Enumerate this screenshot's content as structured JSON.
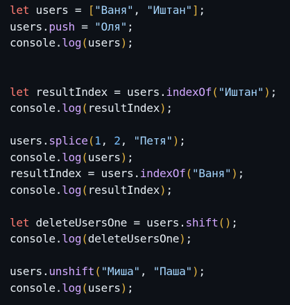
{
  "colors": {
    "background": "#0d1117",
    "plain": "#e6edf3",
    "keyword": "#ff7b72",
    "method": "#d2a8ff",
    "string": "#a5d6ff",
    "number": "#79c0ff",
    "bracket_outer": "#e3b341",
    "bracket_inner": "#d2a8ff"
  },
  "lines": [
    [
      {
        "t": "let",
        "c": "keyword"
      },
      {
        "t": " users = ",
        "c": "plain"
      },
      {
        "t": "[",
        "c": "bracket_outer"
      },
      {
        "t": "\"Ваня\"",
        "c": "string"
      },
      {
        "t": ", ",
        "c": "plain"
      },
      {
        "t": "\"Иштан\"",
        "c": "string"
      },
      {
        "t": "]",
        "c": "bracket_outer"
      },
      {
        "t": ";",
        "c": "plain"
      }
    ],
    [
      {
        "t": "users.",
        "c": "plain"
      },
      {
        "t": "push",
        "c": "method"
      },
      {
        "t": " = ",
        "c": "plain"
      },
      {
        "t": "\"Оля\"",
        "c": "string"
      },
      {
        "t": ";",
        "c": "plain"
      }
    ],
    [
      {
        "t": "console.",
        "c": "plain"
      },
      {
        "t": "log",
        "c": "method"
      },
      {
        "t": "(",
        "c": "bracket_outer"
      },
      {
        "t": "users",
        "c": "plain"
      },
      {
        "t": ")",
        "c": "bracket_outer"
      },
      {
        "t": ";",
        "c": "plain"
      }
    ],
    [],
    [],
    [
      {
        "t": "let",
        "c": "keyword"
      },
      {
        "t": " resultIndex = users.",
        "c": "plain"
      },
      {
        "t": "indexOf",
        "c": "method"
      },
      {
        "t": "(",
        "c": "bracket_outer"
      },
      {
        "t": "\"Иштан\"",
        "c": "string"
      },
      {
        "t": ")",
        "c": "bracket_outer"
      },
      {
        "t": ";",
        "c": "plain"
      }
    ],
    [
      {
        "t": "console.",
        "c": "plain"
      },
      {
        "t": "log",
        "c": "method"
      },
      {
        "t": "(",
        "c": "bracket_outer"
      },
      {
        "t": "resultIndex",
        "c": "plain"
      },
      {
        "t": ")",
        "c": "bracket_outer"
      },
      {
        "t": ";",
        "c": "plain"
      }
    ],
    [],
    [
      {
        "t": "users.",
        "c": "plain"
      },
      {
        "t": "splice",
        "c": "method"
      },
      {
        "t": "(",
        "c": "bracket_outer"
      },
      {
        "t": "1",
        "c": "number"
      },
      {
        "t": ", ",
        "c": "plain"
      },
      {
        "t": "2",
        "c": "number"
      },
      {
        "t": ", ",
        "c": "plain"
      },
      {
        "t": "\"Петя\"",
        "c": "string"
      },
      {
        "t": ")",
        "c": "bracket_outer"
      },
      {
        "t": ";",
        "c": "plain"
      }
    ],
    [
      {
        "t": "console.",
        "c": "plain"
      },
      {
        "t": "log",
        "c": "method"
      },
      {
        "t": "(",
        "c": "bracket_outer"
      },
      {
        "t": "users",
        "c": "plain"
      },
      {
        "t": ")",
        "c": "bracket_outer"
      },
      {
        "t": ";",
        "c": "plain"
      }
    ],
    [
      {
        "t": "resultIndex = users.",
        "c": "plain"
      },
      {
        "t": "indexOf",
        "c": "method"
      },
      {
        "t": "(",
        "c": "bracket_outer"
      },
      {
        "t": "\"Ваня\"",
        "c": "string"
      },
      {
        "t": ")",
        "c": "bracket_outer"
      },
      {
        "t": ";",
        "c": "plain"
      }
    ],
    [
      {
        "t": "console.",
        "c": "plain"
      },
      {
        "t": "log",
        "c": "method"
      },
      {
        "t": "(",
        "c": "bracket_outer"
      },
      {
        "t": "resultIndex",
        "c": "plain"
      },
      {
        "t": ")",
        "c": "bracket_outer"
      },
      {
        "t": ";",
        "c": "plain"
      }
    ],
    [],
    [
      {
        "t": "let",
        "c": "keyword"
      },
      {
        "t": " deleteUsersOne = users.",
        "c": "plain"
      },
      {
        "t": "shift",
        "c": "method"
      },
      {
        "t": "(",
        "c": "bracket_outer"
      },
      {
        "t": ")",
        "c": "bracket_outer"
      },
      {
        "t": ";",
        "c": "plain"
      }
    ],
    [
      {
        "t": "console.",
        "c": "plain"
      },
      {
        "t": "log",
        "c": "method"
      },
      {
        "t": "(",
        "c": "bracket_outer"
      },
      {
        "t": "deleteUsersOne",
        "c": "plain"
      },
      {
        "t": ")",
        "c": "bracket_outer"
      },
      {
        "t": ";",
        "c": "plain"
      }
    ],
    [],
    [
      {
        "t": "users.",
        "c": "plain"
      },
      {
        "t": "unshift",
        "c": "method"
      },
      {
        "t": "(",
        "c": "bracket_outer"
      },
      {
        "t": "\"Миша\"",
        "c": "string"
      },
      {
        "t": ", ",
        "c": "plain"
      },
      {
        "t": "\"Паша\"",
        "c": "string"
      },
      {
        "t": ")",
        "c": "bracket_outer"
      },
      {
        "t": ";",
        "c": "plain"
      }
    ],
    [
      {
        "t": "console.",
        "c": "plain"
      },
      {
        "t": "log",
        "c": "method"
      },
      {
        "t": "(",
        "c": "bracket_outer"
      },
      {
        "t": "users",
        "c": "plain"
      },
      {
        "t": ")",
        "c": "bracket_outer"
      },
      {
        "t": ";",
        "c": "plain"
      }
    ]
  ]
}
